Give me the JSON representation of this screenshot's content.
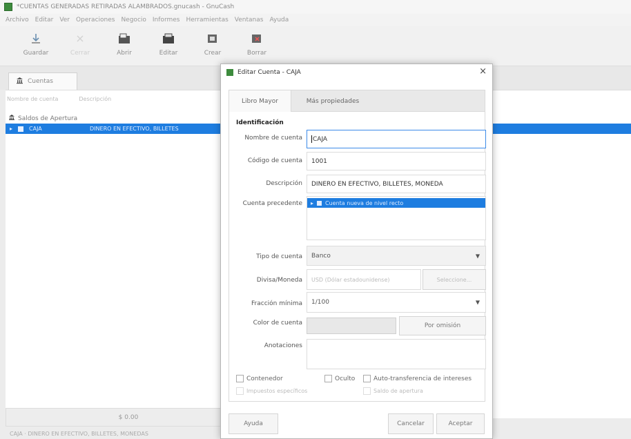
{
  "window": {
    "title": "*CUENTAS GENERADAS RETIRADAS ALAMBRADOS.gnucash - GnuCash",
    "menu": [
      "Archivo",
      "Editar",
      "Ver",
      "Operaciones",
      "Negocio",
      "Informes",
      "Herramientas",
      "Ventanas",
      "Ayuda"
    ]
  },
  "toolbar": {
    "buttons": [
      {
        "label": "Guardar",
        "icon": "save-icon"
      },
      {
        "label": "Cerrar",
        "icon": "close-icon"
      },
      {
        "label": "Abrir",
        "icon": "open-icon"
      },
      {
        "label": "Editar",
        "icon": "edit-icon"
      },
      {
        "label": "Crear",
        "icon": "new-account-icon"
      },
      {
        "label": "Borrar",
        "icon": "delete-icon"
      }
    ]
  },
  "main_tab": {
    "label": "Cuentas",
    "icon": "accounts-icon"
  },
  "account_tree": {
    "columns": [
      "Nombre de cuenta",
      "Descripción"
    ],
    "rows": [
      {
        "name": "Saldos de Apertura",
        "description": ""
      },
      {
        "name": "CAJA",
        "description": "DINERO EN EFECTIVO, BILLETES"
      }
    ],
    "total_label": "$ 0.00"
  },
  "statusbar": {
    "text": "CAJA  ·  DINERO EN EFECTIVO, BILLETES, MONEDAS"
  },
  "dialog": {
    "title": "Editar Cuenta - CAJA",
    "close": "×",
    "tabs": [
      "Libro Mayor",
      "Más propiedades"
    ],
    "group_title": "Identificación",
    "labels": {
      "name": "Nombre de cuenta",
      "code": "Código de cuenta",
      "description": "Descripción",
      "parent": "Cuenta precedente",
      "type": "Tipo de cuenta",
      "commodity": "Divisa/Moneda",
      "smallest_fraction": "Fracción mínima",
      "color": "Color de cuenta",
      "notes": "Anotaciones"
    },
    "values": {
      "name": "CAJA",
      "code": "1001",
      "description": "DINERO EN EFECTIVO, BILLETES, MONEDA",
      "parent": "Cuenta nueva de nivel recto",
      "type": "Banco",
      "commodity": "USD (Dólar estadounidense)",
      "smallest_fraction": "1/100",
      "notes": ""
    },
    "buttons": {
      "select_commodity": "Seleccione...",
      "color": "Por omisión",
      "help": "Ayuda",
      "cancel": "Cancelar",
      "accept": "Aceptar"
    },
    "checkboxes": {
      "placeholder": "Contenedor",
      "hidden": "Oculto",
      "auto_interest": "Auto-transferencia de intereses",
      "tax_related": "Impuestos específicos",
      "opening_balance": "Saldo de apertura"
    }
  },
  "colors": {
    "selection": "#1e7de0",
    "focus": "#3b8ae8"
  }
}
